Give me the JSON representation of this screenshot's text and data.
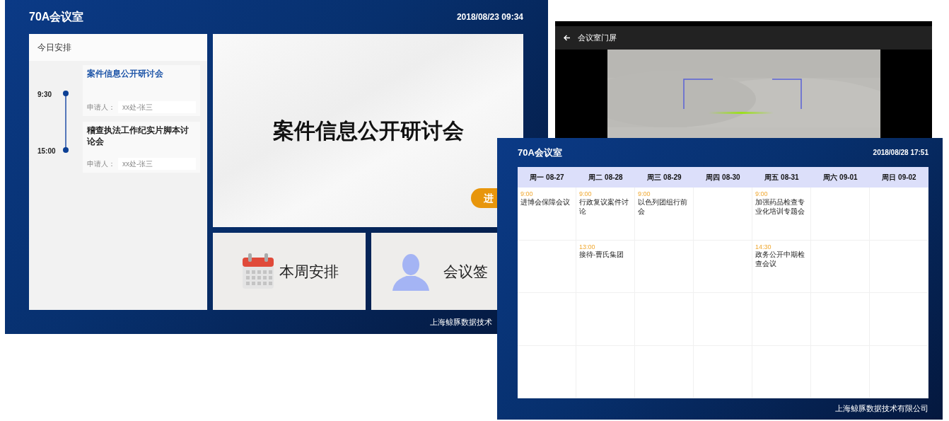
{
  "door_screen": {
    "room": "70A会议室",
    "datetime": "2018/08/23 09:34",
    "today_title": "今日安排",
    "schedule": [
      {
        "time": "9:30",
        "title": "案件信息公开研讨会",
        "current": true,
        "applicant_label": "申请人：",
        "applicant": "xx处-张三"
      },
      {
        "time": "15:00",
        "title": "稽查执法工作纪实片脚本讨论会",
        "current": false,
        "applicant_label": "申请人：",
        "applicant": "xx处-张三"
      }
    ],
    "current_meeting": "案件信息公开研讨会",
    "status": "进",
    "tiles": [
      {
        "kind": "calendar",
        "label": "本周安排"
      },
      {
        "kind": "person",
        "label": "会议签"
      }
    ],
    "footer": "上海鲸豚数据技术"
  },
  "phone_app": {
    "title": "会议室门屏"
  },
  "week_screen": {
    "room": "70A会议室",
    "datetime": "2018/08/28 17:51",
    "days": [
      "周一 08-27",
      "周二 08-28",
      "周三 08-29",
      "周四 08-30",
      "周五 08-31",
      "周六 09-01",
      "周日 09-02"
    ],
    "rows": [
      [
        {
          "time": "9:00",
          "title": "进博会保障会议"
        },
        {
          "time": "9:00",
          "title": "行政复议案件讨论"
        },
        {
          "time": "9:00",
          "title": "以色列团组行前会"
        },
        {},
        {
          "time": "9:00",
          "title": "加强药品检查专业化培训专题会"
        },
        {},
        {}
      ],
      [
        {},
        {
          "time": "13:00",
          "title": "接待-曹氏集团"
        },
        {},
        {},
        {
          "time": "14:30",
          "title": "政务公开中期检查会议"
        },
        {},
        {}
      ],
      [
        {},
        {},
        {},
        {},
        {},
        {},
        {}
      ],
      [
        {},
        {},
        {},
        {},
        {},
        {},
        {}
      ]
    ],
    "footer": "上海鲸豚数据技术有限公司"
  }
}
